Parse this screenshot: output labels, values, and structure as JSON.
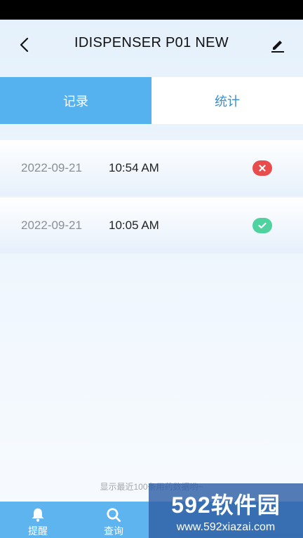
{
  "header": {
    "title": "IDISPENSER P01 NEW"
  },
  "tabs": [
    {
      "label": "记录",
      "active": true
    },
    {
      "label": "统计",
      "active": false
    }
  ],
  "records": [
    {
      "date": "2022-09-21",
      "time": "10:54 AM",
      "status": "fail"
    },
    {
      "date": "2022-09-21",
      "time": "10:05 AM",
      "status": "ok"
    }
  ],
  "footer_note": "显示最近100条用药数据哟~",
  "nav": [
    {
      "label": "提醒",
      "icon": "bell-icon"
    },
    {
      "label": "查询",
      "icon": "search-icon"
    },
    {
      "label": "",
      "icon": "device-icon"
    },
    {
      "label": "",
      "icon": "settings-icon"
    }
  ],
  "watermark": {
    "main": "592软件园",
    "sub": "www.592xiazai.com"
  },
  "colors": {
    "accent": "#55b2ef",
    "fail": "#e84c4c",
    "ok": "#4fd1a0"
  }
}
